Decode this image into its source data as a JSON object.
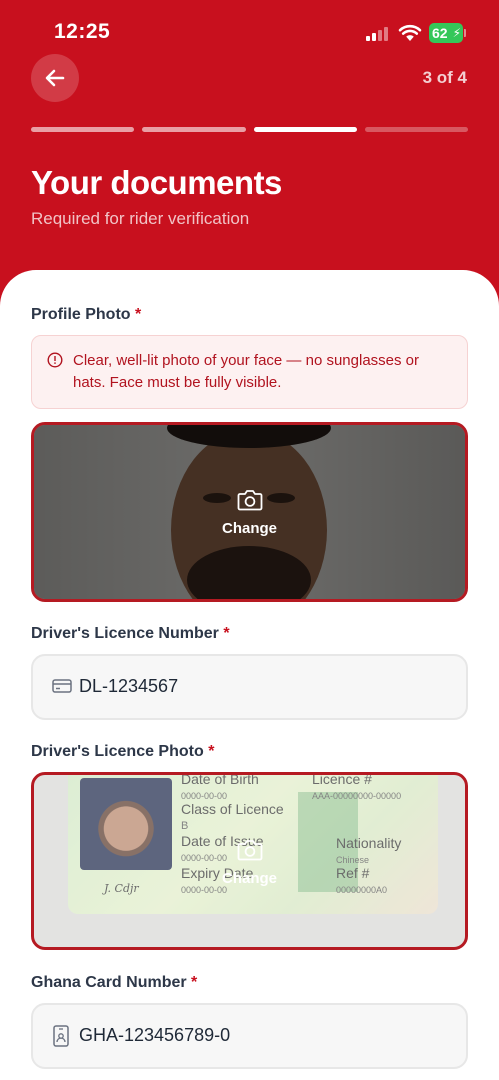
{
  "status_bar": {
    "time": "12:25",
    "battery": "62"
  },
  "header": {
    "step": "3 of 4",
    "title": "Your documents",
    "subtitle": "Required for rider verification",
    "progress": {
      "total": 4,
      "current": 3
    }
  },
  "profile_photo": {
    "label": "Profile Photo",
    "required": "*",
    "hint": "Clear, well-lit photo of your face — no sunglasses or hats. Face must be fully visible.",
    "change_label": "Change"
  },
  "licence_number": {
    "label": "Driver's Licence Number",
    "required": "*",
    "value": "DL-1234567"
  },
  "licence_photo": {
    "label": "Driver's Licence Photo",
    "required": "*",
    "change_label": "Change",
    "card_text": {
      "dob": "Date of Birth",
      "dob_val": "0000-00-00",
      "licence_no": "Licence #",
      "licence_val": "AAA-00000000-00000",
      "class": "Class of Licence",
      "class_val": "B",
      "issue": "Date of Issue",
      "issue_val": "0000-00-00",
      "nationality": "Nationality",
      "nationality_val": "Chinese",
      "expiry": "Expiry Date",
      "expiry_val": "0000-00-00",
      "ref": "Ref #",
      "ref_val": "00000000A0"
    }
  },
  "ghana_card": {
    "label": "Ghana Card Number",
    "required": "*",
    "value": "GHA-123456789-0"
  },
  "colors": {
    "brand": "#c8101e",
    "hint_bg": "#fdf1f1",
    "hint_text": "#b1131f"
  }
}
